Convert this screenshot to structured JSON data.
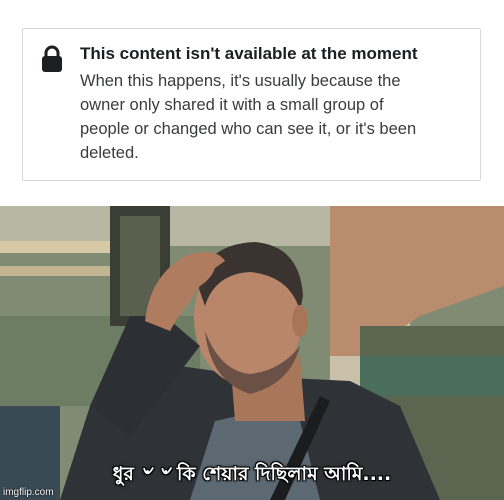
{
  "notice": {
    "icon": "lock-icon",
    "title": "This content isn't available at the moment",
    "lines": [
      "When this happens, it's usually because the",
      "owner only shared it with a small group of",
      "people or changed who can see it, or it's been",
      "deleted."
    ]
  },
  "meme": {
    "caption": "ধুর ৺ ৺ কি শেয়ার দিছিলাম আমি....",
    "watermark": "imgflip.com"
  }
}
